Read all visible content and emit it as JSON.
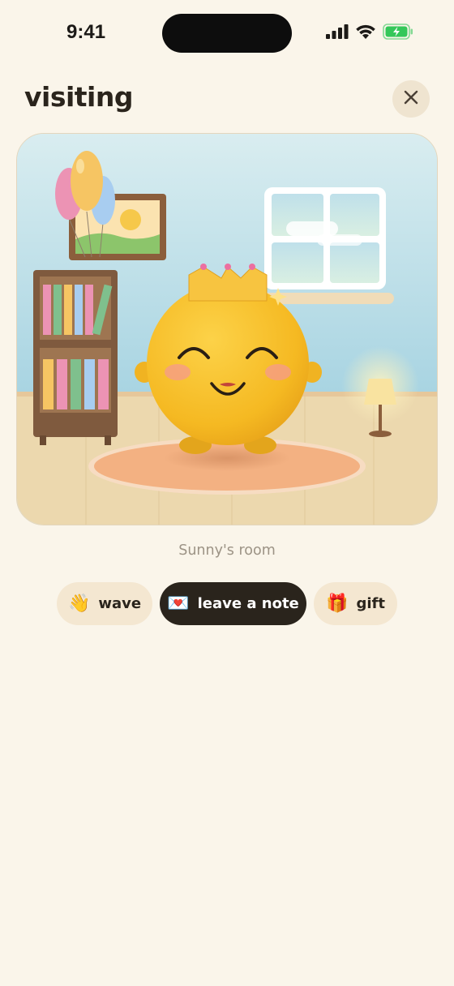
{
  "status": {
    "time": "9:41"
  },
  "header": {
    "title": "visiting"
  },
  "room": {
    "caption": "Sunny's room"
  },
  "actions": [
    {
      "emoji": "👋",
      "label": "wave"
    },
    {
      "emoji": "💌",
      "label": "leave a note"
    },
    {
      "emoji": "🎁",
      "label": "gift"
    }
  ],
  "icons": {
    "close": "close-icon",
    "signal": "signal-icon",
    "wifi": "wifi-icon",
    "battery": "battery-charging-icon"
  },
  "colors": {
    "background": "#faf5ea",
    "accent_dark": "#2a241c",
    "pill_light": "#f4e7d1",
    "battery_green": "#34c759",
    "character_yellow": "#f8c12b"
  }
}
